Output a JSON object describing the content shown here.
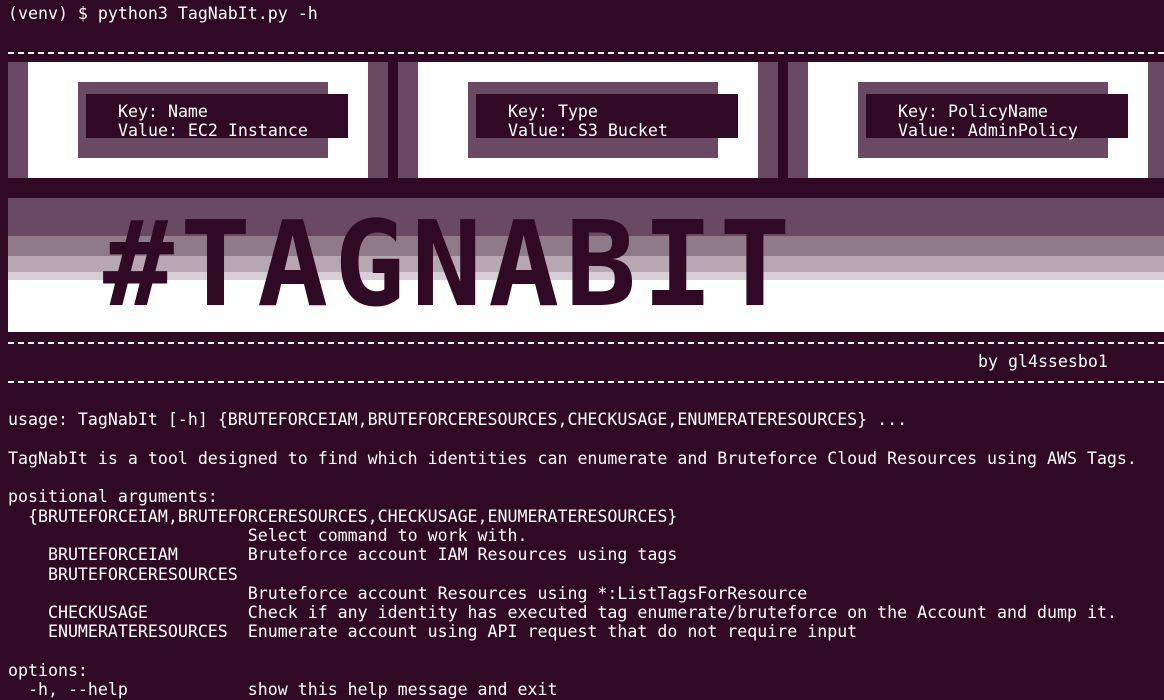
{
  "terminal": {
    "prompt_line": "(venv) $ python3 TagNabIt.py -h",
    "tags": [
      {
        "key_line": "Key: Name",
        "value_line": "Value: EC2 Instance"
      },
      {
        "key_line": "Key: Type",
        "value_line": "Value: S3 Bucket"
      },
      {
        "key_line": "Key: PolicyName",
        "value_line": "Value: AdminPolicy"
      }
    ],
    "logo_text": "#TAGNABIT",
    "author": "by gl4ssesbo1",
    "usage": "usage: TagNabIt [-h] {BRUTEFORCEIAM,BRUTEFORCERESOURCES,CHECKUSAGE,ENUMERATERESOURCES} ...",
    "description": "TagNabIt is a tool designed to find which identities can enumerate and Bruteforce Cloud Resources using AWS Tags.",
    "positional_header": "positional arguments:",
    "positional_choices": "  {BRUTEFORCEIAM,BRUTEFORCERESOURCES,CHECKUSAGE,ENUMERATERESOURCES}",
    "select_line": "                        Select command to work with.",
    "cmd_bruteforceiam": "    BRUTEFORCEIAM       Bruteforce account IAM Resources using tags",
    "cmd_bruteforceresources": "    BRUTEFORCERESOURCES",
    "cmd_bruteforceresources_desc": "                        Bruteforce account Resources using *:ListTagsForResource",
    "cmd_checkusage": "    CHECKUSAGE          Check if any identity has executed tag enumerate/bruteforce on the Account and dump it.",
    "cmd_enumerate": "    ENUMERATERESOURCES  Enumerate account using API request that do not require input",
    "options_header": "options:",
    "help_option": "  -h, --help            show this help message and exit"
  },
  "colors": {
    "background": "#300a24",
    "foreground": "#ffffff",
    "shade_dark": "#6a4a62",
    "shade_light": "#b7a7b3"
  }
}
